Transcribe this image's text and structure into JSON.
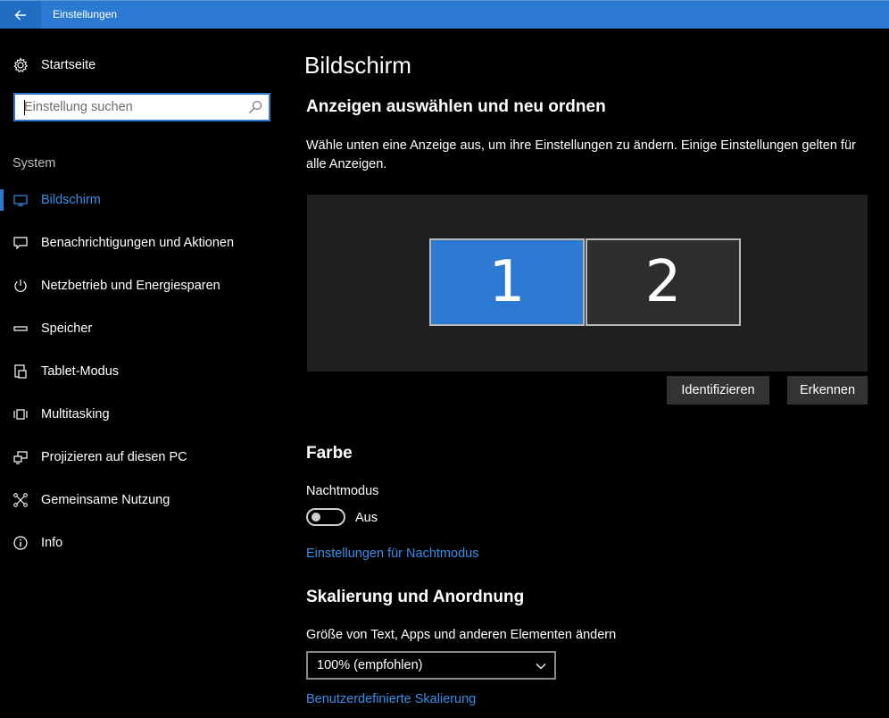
{
  "window": {
    "title": "Einstellungen",
    "accent_color": "#2b79d0"
  },
  "sidebar": {
    "home_label": "Startseite",
    "home_icon": "gear-icon",
    "search_placeholder": "Einstellung suchen",
    "section_label": "System",
    "items": [
      {
        "label": "Bildschirm",
        "icon": "monitor-icon",
        "active": true
      },
      {
        "label": "Benachrichtigungen und Aktionen",
        "icon": "message-icon",
        "active": false
      },
      {
        "label": "Netzbetrieb und Energiesparen",
        "icon": "power-icon",
        "active": false
      },
      {
        "label": "Speicher",
        "icon": "storage-icon",
        "active": false
      },
      {
        "label": "Tablet-Modus",
        "icon": "tablet-icon",
        "active": false
      },
      {
        "label": "Multitasking",
        "icon": "multitasking-icon",
        "active": false
      },
      {
        "label": "Projizieren auf diesen PC",
        "icon": "project-icon",
        "active": false
      },
      {
        "label": "Gemeinsame Nutzung",
        "icon": "share-icon",
        "active": false
      },
      {
        "label": "Info",
        "icon": "info-icon",
        "active": false
      }
    ]
  },
  "main": {
    "page_title": "Bildschirm",
    "arrange": {
      "heading": "Anzeigen auswählen und neu ordnen",
      "description": "Wähle unten eine Anzeige aus, um ihre Einstellungen zu ändern. Einige Einstellungen gelten für alle Anzeigen.",
      "monitors": [
        "1",
        "2"
      ],
      "selected_monitor": "1",
      "identify_label": "Identifizieren",
      "detect_label": "Erkennen"
    },
    "color": {
      "heading": "Farbe",
      "night_mode_label": "Nachtmodus",
      "night_mode_state": "Aus",
      "night_mode_on": false,
      "night_mode_settings_link": "Einstellungen für Nachtmodus"
    },
    "scale": {
      "heading": "Skalierung und Anordnung",
      "size_label": "Größe von Text, Apps und anderen Elementen ändern",
      "size_value": "100% (empfohlen)",
      "custom_scale_link": "Benutzerdefinierte Skalierung"
    }
  }
}
